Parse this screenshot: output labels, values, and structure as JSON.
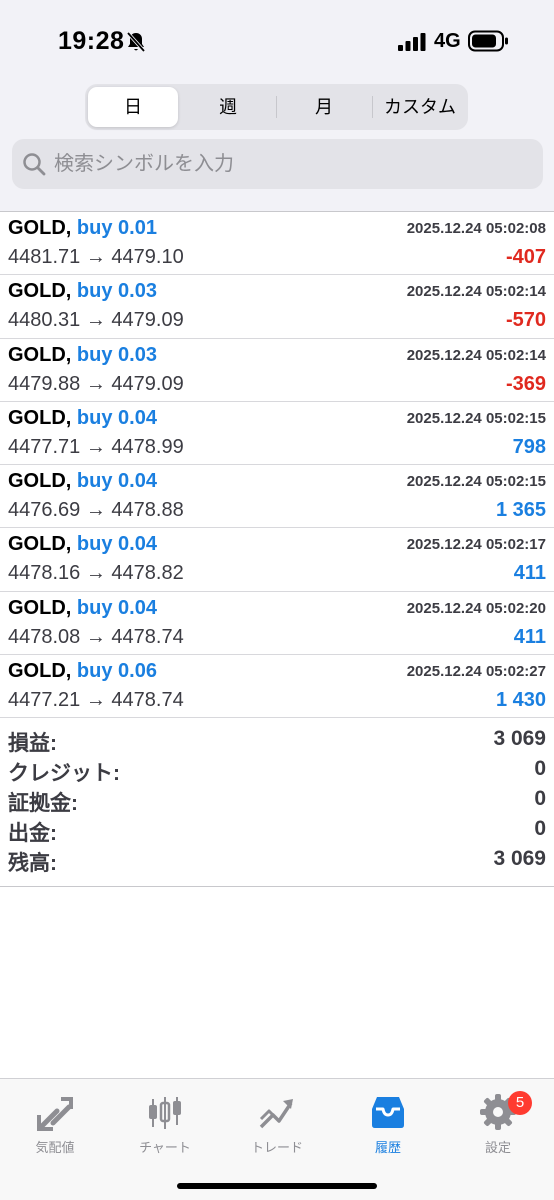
{
  "status": {
    "time": "19:28",
    "network": "4G"
  },
  "period_tabs": [
    {
      "label": "日",
      "active": true
    },
    {
      "label": "週",
      "active": false
    },
    {
      "label": "月",
      "active": false
    },
    {
      "label": "カスタム",
      "active": false
    }
  ],
  "search": {
    "placeholder": "検索シンボルを入力"
  },
  "deals": [
    {
      "symbol": "GOLD,",
      "type": "buy 0.01",
      "time": "2025.12.24 05:02:08",
      "prices": "4481.71 → 4479.10",
      "profit": "-407",
      "sign": "neg"
    },
    {
      "symbol": "GOLD,",
      "type": "buy 0.03",
      "time": "2025.12.24 05:02:14",
      "prices": "4480.31 → 4479.09",
      "profit": "-570",
      "sign": "neg"
    },
    {
      "symbol": "GOLD,",
      "type": "buy 0.03",
      "time": "2025.12.24 05:02:14",
      "prices": "4479.88 → 4479.09",
      "profit": "-369",
      "sign": "neg"
    },
    {
      "symbol": "GOLD,",
      "type": "buy 0.04",
      "time": "2025.12.24 05:02:15",
      "prices": "4477.71 → 4478.99",
      "profit": "798",
      "sign": "pos"
    },
    {
      "symbol": "GOLD,",
      "type": "buy 0.04",
      "time": "2025.12.24 05:02:15",
      "prices": "4476.69 → 4478.88",
      "profit": "1 365",
      "sign": "pos"
    },
    {
      "symbol": "GOLD,",
      "type": "buy 0.04",
      "time": "2025.12.24 05:02:17",
      "prices": "4478.16 → 4478.82",
      "profit": "411",
      "sign": "pos"
    },
    {
      "symbol": "GOLD,",
      "type": "buy 0.04",
      "time": "2025.12.24 05:02:20",
      "prices": "4478.08 → 4478.74",
      "profit": "411",
      "sign": "pos"
    },
    {
      "symbol": "GOLD,",
      "type": "buy 0.06",
      "time": "2025.12.24 05:02:27",
      "prices": "4477.21 → 4478.74",
      "profit": "1 430",
      "sign": "pos"
    }
  ],
  "summary": [
    {
      "label": "損益:",
      "value": "3 069"
    },
    {
      "label": "クレジット:",
      "value": "0"
    },
    {
      "label": "証拠金:",
      "value": "0"
    },
    {
      "label": "出金:",
      "value": "0"
    },
    {
      "label": "残高:",
      "value": "3 069"
    }
  ],
  "tabbar": {
    "quotes": "気配値",
    "chart": "チャート",
    "trade": "トレード",
    "history": "履歴",
    "settings": "設定",
    "settings_badge": "5"
  },
  "colors": {
    "accent": "#1a7fe0",
    "negative": "#e0291f",
    "badge": "#ff3b30"
  },
  "icons": [
    "bell-slash-icon",
    "signal-icon",
    "battery-icon",
    "search-icon",
    "quotes-icon",
    "chart-icon",
    "trade-icon",
    "history-icon",
    "gear-icon"
  ]
}
